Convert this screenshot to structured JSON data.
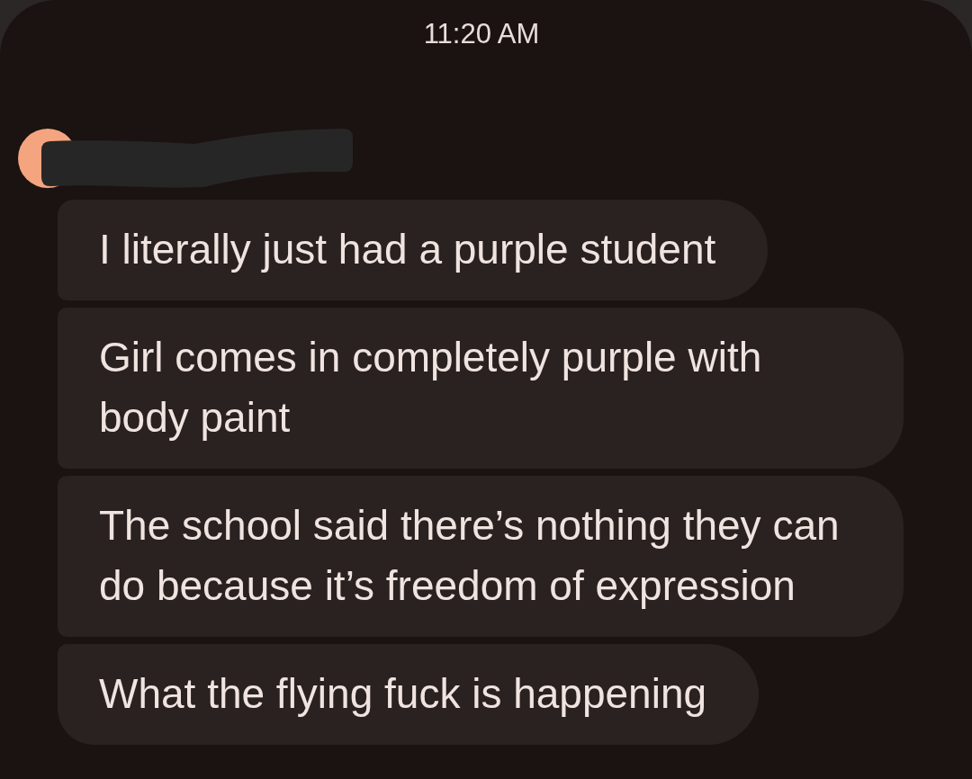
{
  "timestamp": "11:20 AM",
  "sender": {
    "name_redacted": true
  },
  "messages": [
    {
      "text": "I literally just had a purple student"
    },
    {
      "text": "Girl comes in completely purple with body paint"
    },
    {
      "text": "The school said there’s nothing they can do because it’s freedom of expression"
    },
    {
      "text": "What the flying fuck is happening"
    }
  ]
}
